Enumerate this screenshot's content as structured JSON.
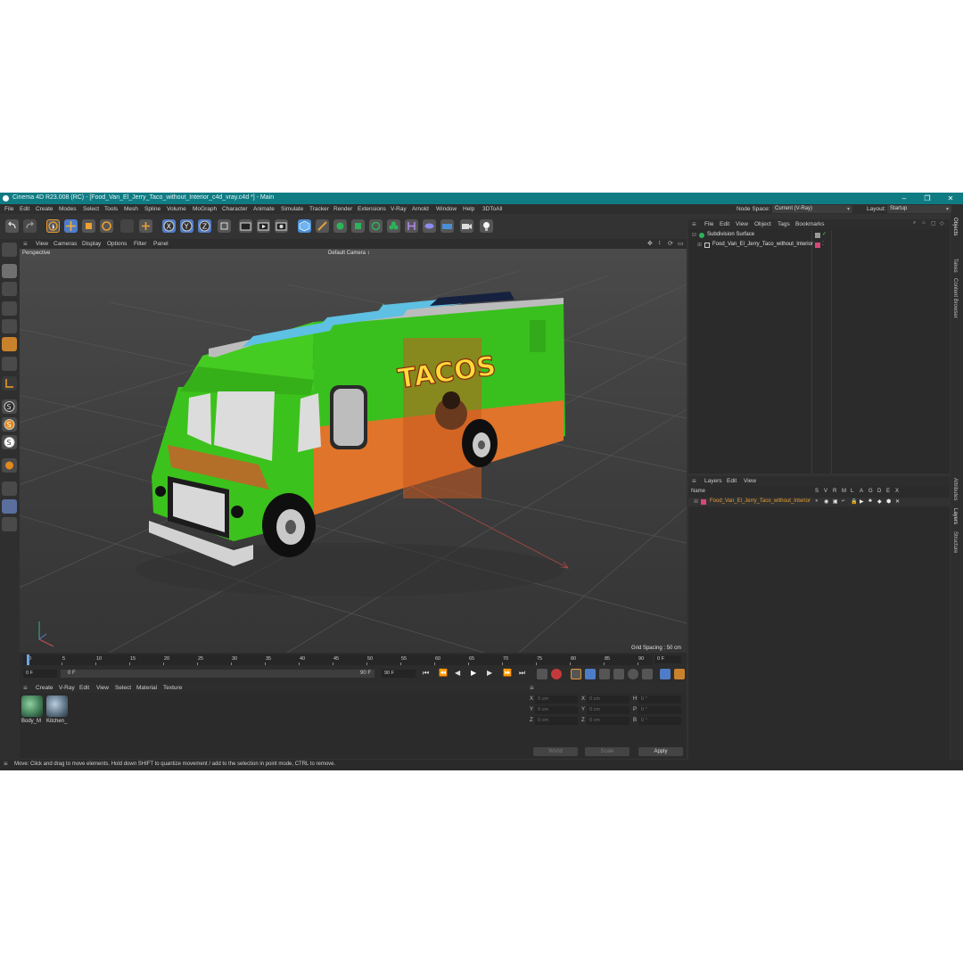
{
  "window": {
    "title": "Cinema 4D R23.008 (RC) - [Food_Van_El_Jerry_Taco_without_Interior_c4d_vray.c4d *] - Main",
    "minimize": "–",
    "maximize": "❐",
    "close": "✕"
  },
  "menu": [
    "File",
    "Edit",
    "Create",
    "Modes",
    "Select",
    "Tools",
    "Mesh",
    "Spline",
    "Volume",
    "MoGraph",
    "Character",
    "Animate",
    "Simulate",
    "Tracker",
    "Render",
    "Extensions",
    "V-Ray",
    "Arnold",
    "Window",
    "Help",
    "3DToAll"
  ],
  "node_space": {
    "label": "Node Space:",
    "value": "Current (V-Ray)"
  },
  "layout": {
    "label": "Layout:",
    "value": "Startup"
  },
  "viewport": {
    "menu": [
      "View",
      "Cameras",
      "Display",
      "Options",
      "Filter",
      "Panel"
    ],
    "name": "Perspective",
    "camera": "Default Camera",
    "grid_spacing": "Grid Spacing : 50 cm"
  },
  "timeline": {
    "ticks": [
      "0",
      "5",
      "10",
      "15",
      "20",
      "25",
      "30",
      "35",
      "40",
      "45",
      "50",
      "55",
      "60",
      "65",
      "70",
      "75",
      "80",
      "85",
      "90"
    ],
    "current_frame": "0 F",
    "start": "0 F",
    "range_start": "0 F",
    "range_end": "90 F",
    "end": "90 F"
  },
  "material_manager": {
    "menu": [
      "Create",
      "V-Ray",
      "Edit",
      "View",
      "Select",
      "Material",
      "Texture"
    ],
    "materials": [
      {
        "name": "Body_M",
        "color": "#3f7a55"
      },
      {
        "name": "Kitchen_",
        "color": "#5a6f80"
      }
    ]
  },
  "coordinates": {
    "rows": [
      {
        "a": "X",
        "av": "0 cm",
        "b": "X",
        "bv": "0 cm",
        "c": "H",
        "cv": "0 °"
      },
      {
        "a": "Y",
        "av": "0 cm",
        "b": "Y",
        "bv": "0 cm",
        "c": "P",
        "cv": "0 °"
      },
      {
        "a": "Z",
        "av": "0 cm",
        "b": "Z",
        "bv": "0 cm",
        "c": "B",
        "cv": "0 °"
      }
    ],
    "mode1": "World",
    "mode2": "Scale",
    "apply": "Apply"
  },
  "objects": {
    "menu": [
      "File",
      "Edit",
      "View",
      "Object",
      "Tags",
      "Bookmarks"
    ],
    "items": [
      {
        "name": "Subdivision Surface"
      },
      {
        "name": "Food_Van_El_Jerry_Taco_without_Interior"
      }
    ]
  },
  "layers": {
    "menu": [
      "Layers",
      "Edit",
      "View"
    ],
    "header_name": "Name",
    "columns": [
      "S",
      "V",
      "R",
      "M",
      "L",
      "A",
      "G",
      "D",
      "E",
      "X"
    ],
    "items": [
      {
        "name": "Food_Van_El_Jerry_Taco_without_Interior",
        "color": "#d9477a"
      }
    ]
  },
  "side_tabs": [
    "Objects",
    "Takes",
    "Content Browser",
    "Attributes",
    "Layers",
    "Structure"
  ],
  "status": "Move: Click and drag to move elements. Hold down SHIFT to quantize movement / add to the selection in point mode, CTRL to remove.",
  "truck_text": {
    "side": "TACOS"
  }
}
